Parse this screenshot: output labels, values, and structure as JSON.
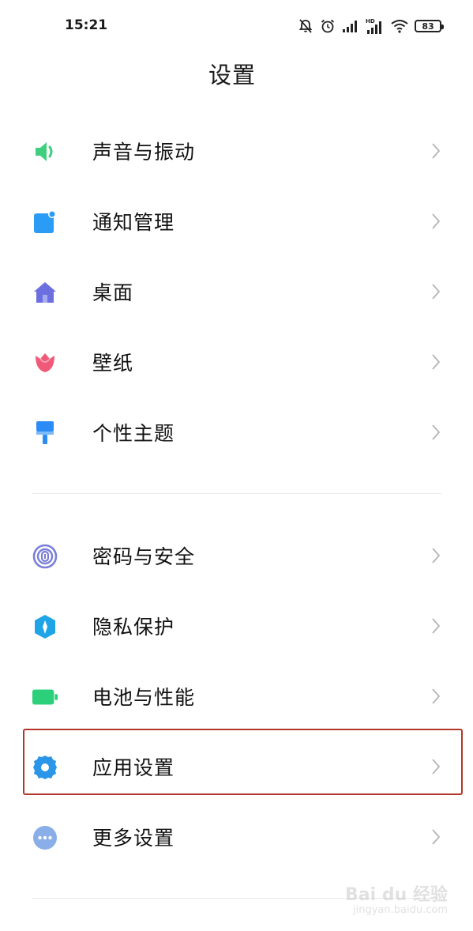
{
  "status_bar": {
    "time": "15:21",
    "battery_level": "83",
    "icons": [
      "mute-icon",
      "alarm-icon",
      "signal-icon",
      "hd-signal-icon",
      "wifi-icon",
      "battery-icon"
    ]
  },
  "header": {
    "title": "设置"
  },
  "groups": [
    {
      "items": [
        {
          "label": "声音与振动",
          "icon": "speaker-icon",
          "color": "#3fcf7e"
        },
        {
          "label": "通知管理",
          "icon": "notification-icon",
          "color": "#2b9cf5"
        },
        {
          "label": "桌面",
          "icon": "home-icon",
          "color": "#6b6fe0"
        },
        {
          "label": "壁纸",
          "icon": "tulip-icon",
          "color": "#f05a78"
        },
        {
          "label": "个性主题",
          "icon": "brush-icon",
          "color": "#2b8cf5"
        }
      ]
    },
    {
      "items": [
        {
          "label": "密码与安全",
          "icon": "fingerprint-icon",
          "color": "#7a7fd8"
        },
        {
          "label": "隐私保护",
          "icon": "privacy-shield-icon",
          "color": "#1fa4e8"
        },
        {
          "label": "电池与性能",
          "icon": "battery-performance-icon",
          "color": "#2dd07a"
        },
        {
          "label": "应用设置",
          "icon": "app-settings-gear-icon",
          "color": "#2b95e8",
          "highlighted": true
        },
        {
          "label": "更多设置",
          "icon": "more-dots-icon",
          "color": "#8aaee8"
        }
      ]
    }
  ],
  "highlight_color": "#b2372b",
  "watermark": {
    "brand": "Bai du 经验",
    "sub": "jingyan.baidu.com"
  }
}
